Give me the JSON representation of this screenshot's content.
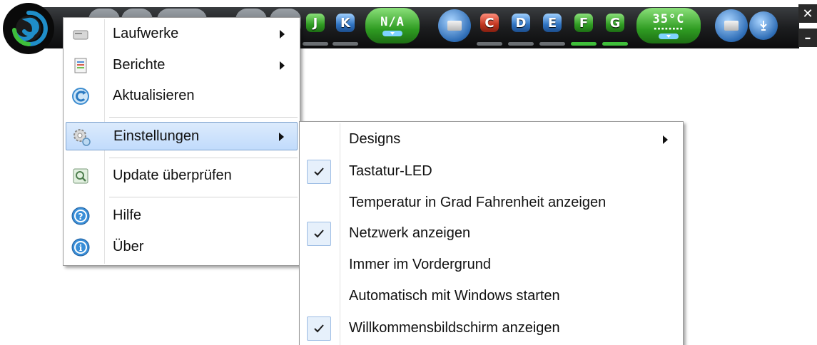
{
  "toolbar": {
    "drive_keys": [
      "J",
      "K",
      "C",
      "D",
      "E",
      "F",
      "G"
    ],
    "status_na": "N/A",
    "temperature": "35°C",
    "temperature_bar": "▪▪▪▪▪▪▪▪",
    "window_close": "✕",
    "window_minimize": "–"
  },
  "main_menu": {
    "items": [
      {
        "label": "Laufwerke",
        "icon": "drive-icon",
        "submenu": true
      },
      {
        "label": "Berichte",
        "icon": "report-icon",
        "submenu": true
      },
      {
        "label": "Aktualisieren",
        "icon": "refresh-icon",
        "submenu": false
      },
      {
        "label": "Einstellungen",
        "icon": "settings-icon",
        "submenu": true,
        "highlighted": true
      },
      {
        "label": "Update überprüfen",
        "icon": "update-check-icon",
        "submenu": false
      },
      {
        "label": "Hilfe",
        "icon": "help-icon",
        "submenu": false
      },
      {
        "label": "Über",
        "icon": "info-icon",
        "submenu": false
      }
    ]
  },
  "settings_menu": {
    "items": [
      {
        "label": "Designs",
        "checked": false,
        "submenu": true
      },
      {
        "label": "Tastatur-LED",
        "checked": true,
        "submenu": false
      },
      {
        "label": "Temperatur in Grad Fahrenheit anzeigen",
        "checked": false,
        "submenu": false
      },
      {
        "label": "Netzwerk anzeigen",
        "checked": true,
        "submenu": false
      },
      {
        "label": "Immer im Vordergrund",
        "checked": false,
        "submenu": false
      },
      {
        "label": "Automatisch mit Windows starten",
        "checked": false,
        "submenu": false
      },
      {
        "label": "Willkommensbildschirm anzeigen",
        "checked": true,
        "submenu": false
      }
    ]
  },
  "colors": {
    "highlight_fill": "#c9e0fc",
    "highlight_border": "#7da2ce",
    "check_fill": "#e6f0fb",
    "accent_green": "#2f9c22",
    "accent_blue": "#2e6db6",
    "accent_red": "#c2351f"
  }
}
